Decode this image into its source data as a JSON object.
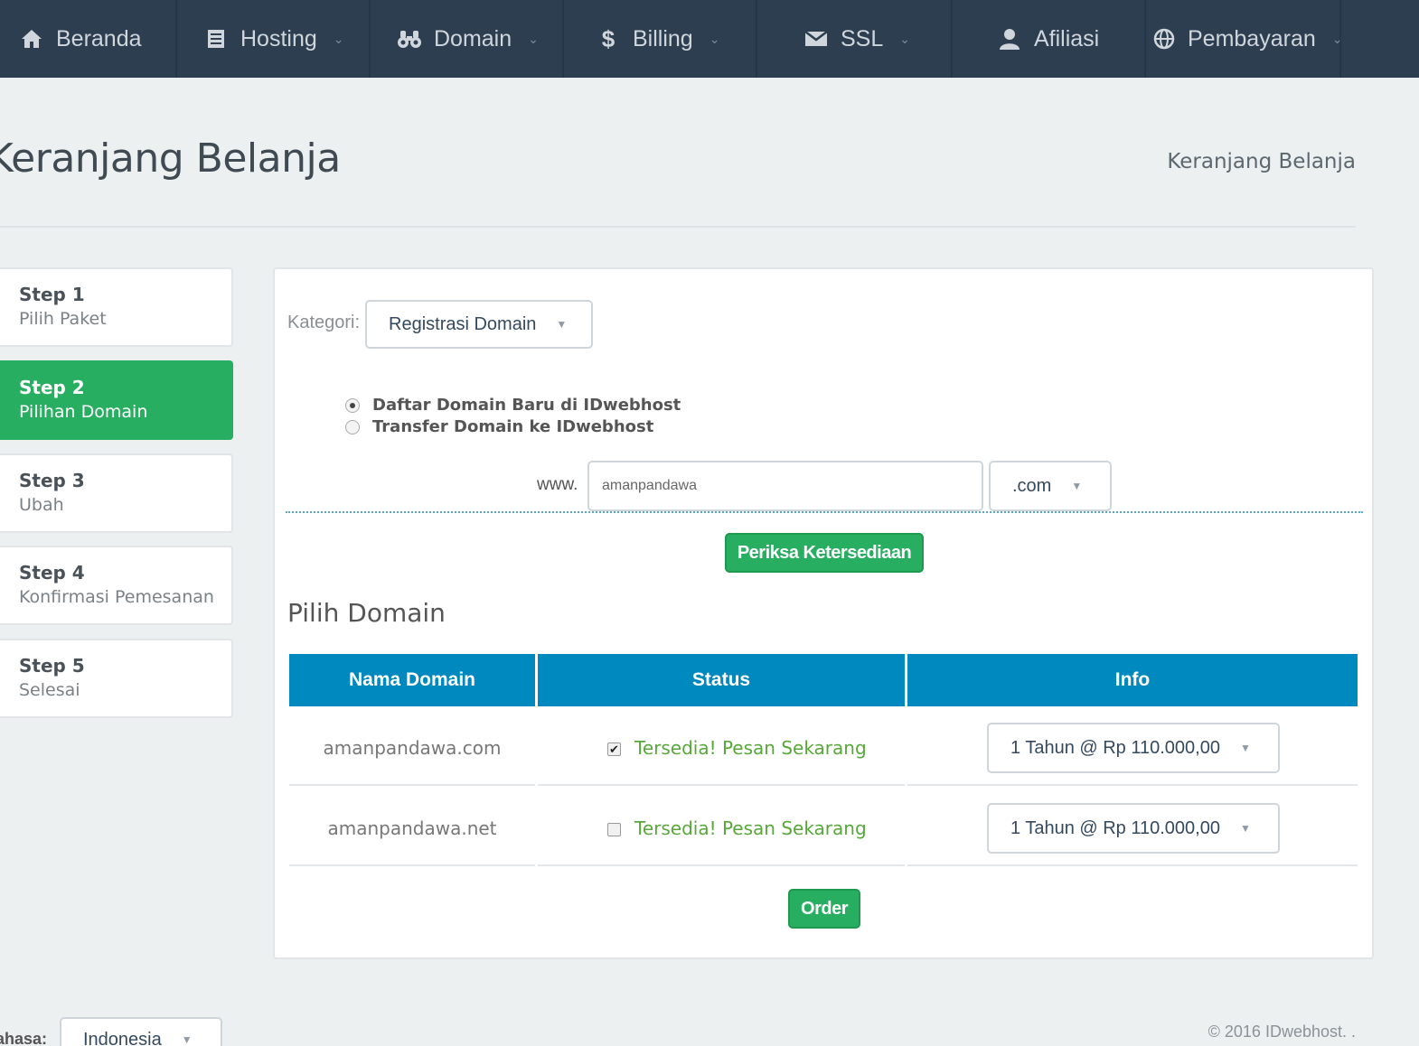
{
  "nav": {
    "items": [
      {
        "label": "Beranda",
        "icon": "home-icon",
        "has_caret": false
      },
      {
        "label": "Hosting",
        "icon": "document-icon",
        "has_caret": true
      },
      {
        "label": "Domain",
        "icon": "binoculars-icon",
        "has_caret": true
      },
      {
        "label": "Billing",
        "icon": "dollar-icon",
        "has_caret": true
      },
      {
        "label": "SSL",
        "icon": "envelope-icon",
        "has_caret": true
      },
      {
        "label": "Afiliasi",
        "icon": "user-icon",
        "has_caret": false
      },
      {
        "label": "Pembayaran",
        "icon": "globe-icon",
        "has_caret": true
      }
    ]
  },
  "header": {
    "title": "Keranjang Belanja",
    "breadcrumb": "Keranjang Belanja"
  },
  "steps": [
    {
      "title": "Step 1",
      "subtitle": "Pilih Paket",
      "active": false
    },
    {
      "title": "Step 2",
      "subtitle": "Pilihan Domain",
      "active": true
    },
    {
      "title": "Step 3",
      "subtitle": "Ubah",
      "active": false
    },
    {
      "title": "Step 4",
      "subtitle": "Konfirmasi Pemesanan",
      "active": false
    },
    {
      "title": "Step 5",
      "subtitle": "Selesai",
      "active": false
    }
  ],
  "form": {
    "kategori_label": "Kategori:",
    "kategori_value": "Registrasi Domain",
    "radio_options": [
      {
        "label": "Daftar Domain Baru di IDwebhost",
        "checked": true
      },
      {
        "label": "Transfer Domain ke IDwebhost",
        "checked": false
      }
    ],
    "www_label": "www.",
    "domain_value": "amanpandawa",
    "tld_value": ".com",
    "check_button": "Periksa Ketersediaan"
  },
  "results": {
    "title": "Pilih Domain",
    "columns": [
      "Nama Domain",
      "Status",
      "Info"
    ],
    "rows": [
      {
        "domain": "amanpandawa.com",
        "checked": true,
        "status": "Tersedia! Pesan Sekarang",
        "price": "1 Tahun @ Rp 110.000,00"
      },
      {
        "domain": "amanpandawa.net",
        "checked": false,
        "status": "Tersedia! Pesan Sekarang",
        "price": "1 Tahun @ Rp 110.000,00"
      }
    ],
    "order_button": "Order"
  },
  "footer": {
    "language_label": "Bahasa:",
    "language_value": "Indonesia",
    "copyright": "© 2016 IDwebhost. ."
  },
  "colors": {
    "nav_bg": "#2c3e50",
    "accent_green": "#27ae60",
    "table_header": "#0089bf",
    "available_text": "#57a839"
  }
}
